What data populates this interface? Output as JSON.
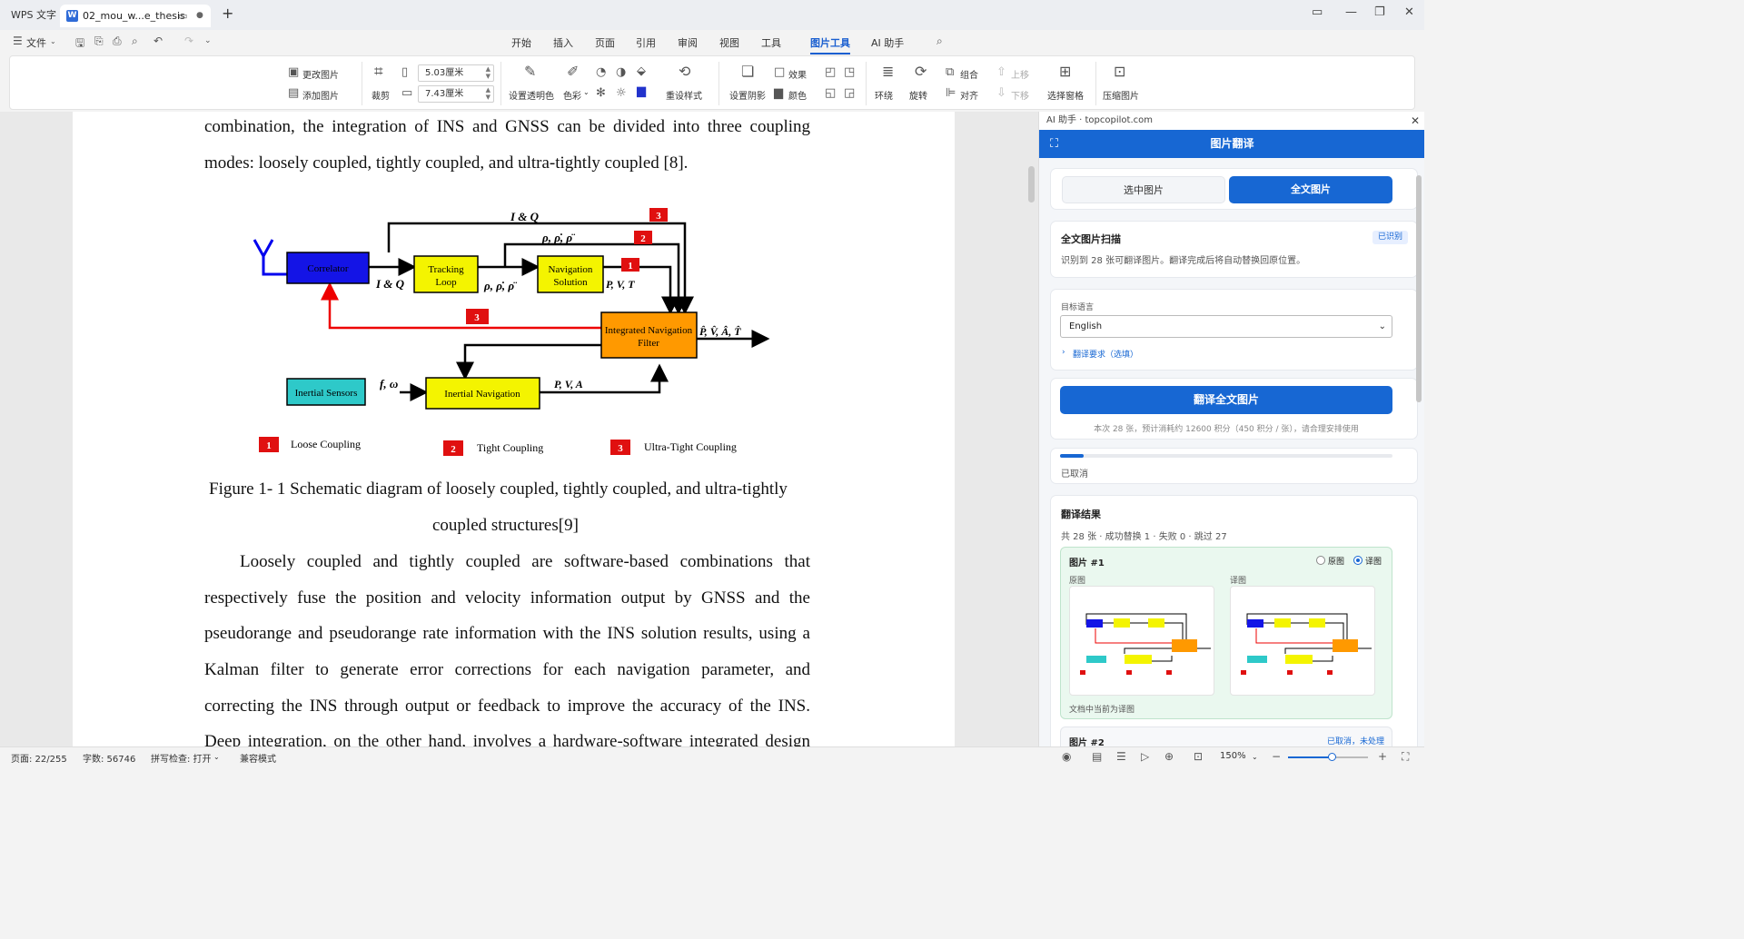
{
  "titlebar": {
    "app_tab": "WPS 文字",
    "doc_tab": "02_mou_w...e_thesis",
    "add_tab": "+"
  },
  "menubar": {
    "file_label": "文件",
    "tabs": [
      "开始",
      "插入",
      "页面",
      "引用",
      "审阅",
      "视图",
      "工具",
      "图片工具",
      "AI 助手"
    ],
    "active_tab": "图片工具"
  },
  "ribbon": {
    "change_image": "更改图片",
    "add_image": "添加图片",
    "crop": "裁剪",
    "width_value": "5.03厘米",
    "height_value": "7.43厘米",
    "transparent": "设置透明色",
    "color_style": "色彩",
    "redo_style": "重设样式",
    "set_shadow": "设置阴影",
    "effect": "效果",
    "color": "颜色",
    "wrap": "环绕",
    "rotate": "旋转",
    "group": "组合",
    "align": "对齐",
    "move_up": "上移",
    "move_down": "下移",
    "selection_pane": "选择窗格",
    "compress": "压缩图片"
  },
  "document": {
    "lines_top": [
      "combination, the integration of INS and GNSS can be divided into three coupling",
      "modes: loosely coupled, tightly coupled, and ultra-tightly coupled [8]."
    ],
    "caption_1": "Figure 1- 1 Schematic diagram of loosely coupled, tightly coupled, and ultra-tightly",
    "caption_2": "coupled structures[9]",
    "paragraph_lines": [
      "Loosely coupled and tightly coupled are software-based combinations that",
      "respectively fuse the position and velocity information output by GNSS and the",
      "pseudorange and pseudorange rate information with the INS solution results, using a",
      "Kalman filter to generate error corrections for each navigation parameter, and",
      "correcting the INS through output or feedback to improve the accuracy of the INS.",
      "Deep integration, on the other hand, involves a hardware-software integrated design"
    ]
  },
  "figure": {
    "correlator": "Correlator",
    "tracking_1": "Tracking",
    "tracking_2": "Loop",
    "nav_sol_1": "Navigation",
    "nav_sol_2": "Solution",
    "inf_1": "Integrated Navigation",
    "inf_2": "Filter",
    "inertial_sensors": "Inertial Sensors",
    "inertial_nav": "Inertial Navigation",
    "lbl_iq_top": "I & Q",
    "lbl_iq_mid": "I & Q",
    "lbl_rho_top": "ρ, ρ̇, ρ̈",
    "lbl_rho_mid": "ρ, ρ̇, ρ̈",
    "lbl_pvt": "P, V, T",
    "lbl_out": "P̂, V̂, Â, T̂",
    "lbl_fw": "f, ω",
    "lbl_pva": "P, V, A",
    "num_1": "1",
    "num_2": "2",
    "num_3": "3",
    "legend_loose": "Loose Coupling",
    "legend_tight": "Tight Coupling",
    "legend_ultra": "Ultra-Tight Coupling"
  },
  "panel": {
    "top_title": "AI 助手 · topcopilot.com",
    "header": "图片翻译",
    "seg_selected": "选中图片",
    "seg_all": "全文图片",
    "scan_title": "全文图片扫描",
    "scan_badge": "已识别",
    "scan_desc": "识别到 28 张可翻译图片。翻译完成后将自动替换回原位置。",
    "target_lang_label": "目标语言",
    "target_lang_value": "English",
    "requirements": "翻译要求（选填）",
    "translate_btn": "翻译全文图片",
    "cost_note": "本次 28 张，预计消耗约 12600 积分（450 积分 / 张），请合理安排使用",
    "progress": 0.07,
    "progress_status": "已取消",
    "results_title": "翻译结果",
    "results_summary": "共 28 张 · 成功替换 1 · 失败 0 · 跳过 27",
    "item1_title": "图片 #1",
    "radio_original": "原图",
    "radio_translated": "译图",
    "col_original": "原图",
    "col_translated": "译图",
    "item1_note": "文档中当前为译图",
    "item2_title": "图片 #2",
    "item2_status": "已取消，未处理"
  },
  "statusbar": {
    "page": "页面: 22/255",
    "words": "字数: 56746",
    "spell": "拼写检查: 打开",
    "compat": "兼容模式",
    "zoom": "150%",
    "zoom_level": 0.55
  }
}
